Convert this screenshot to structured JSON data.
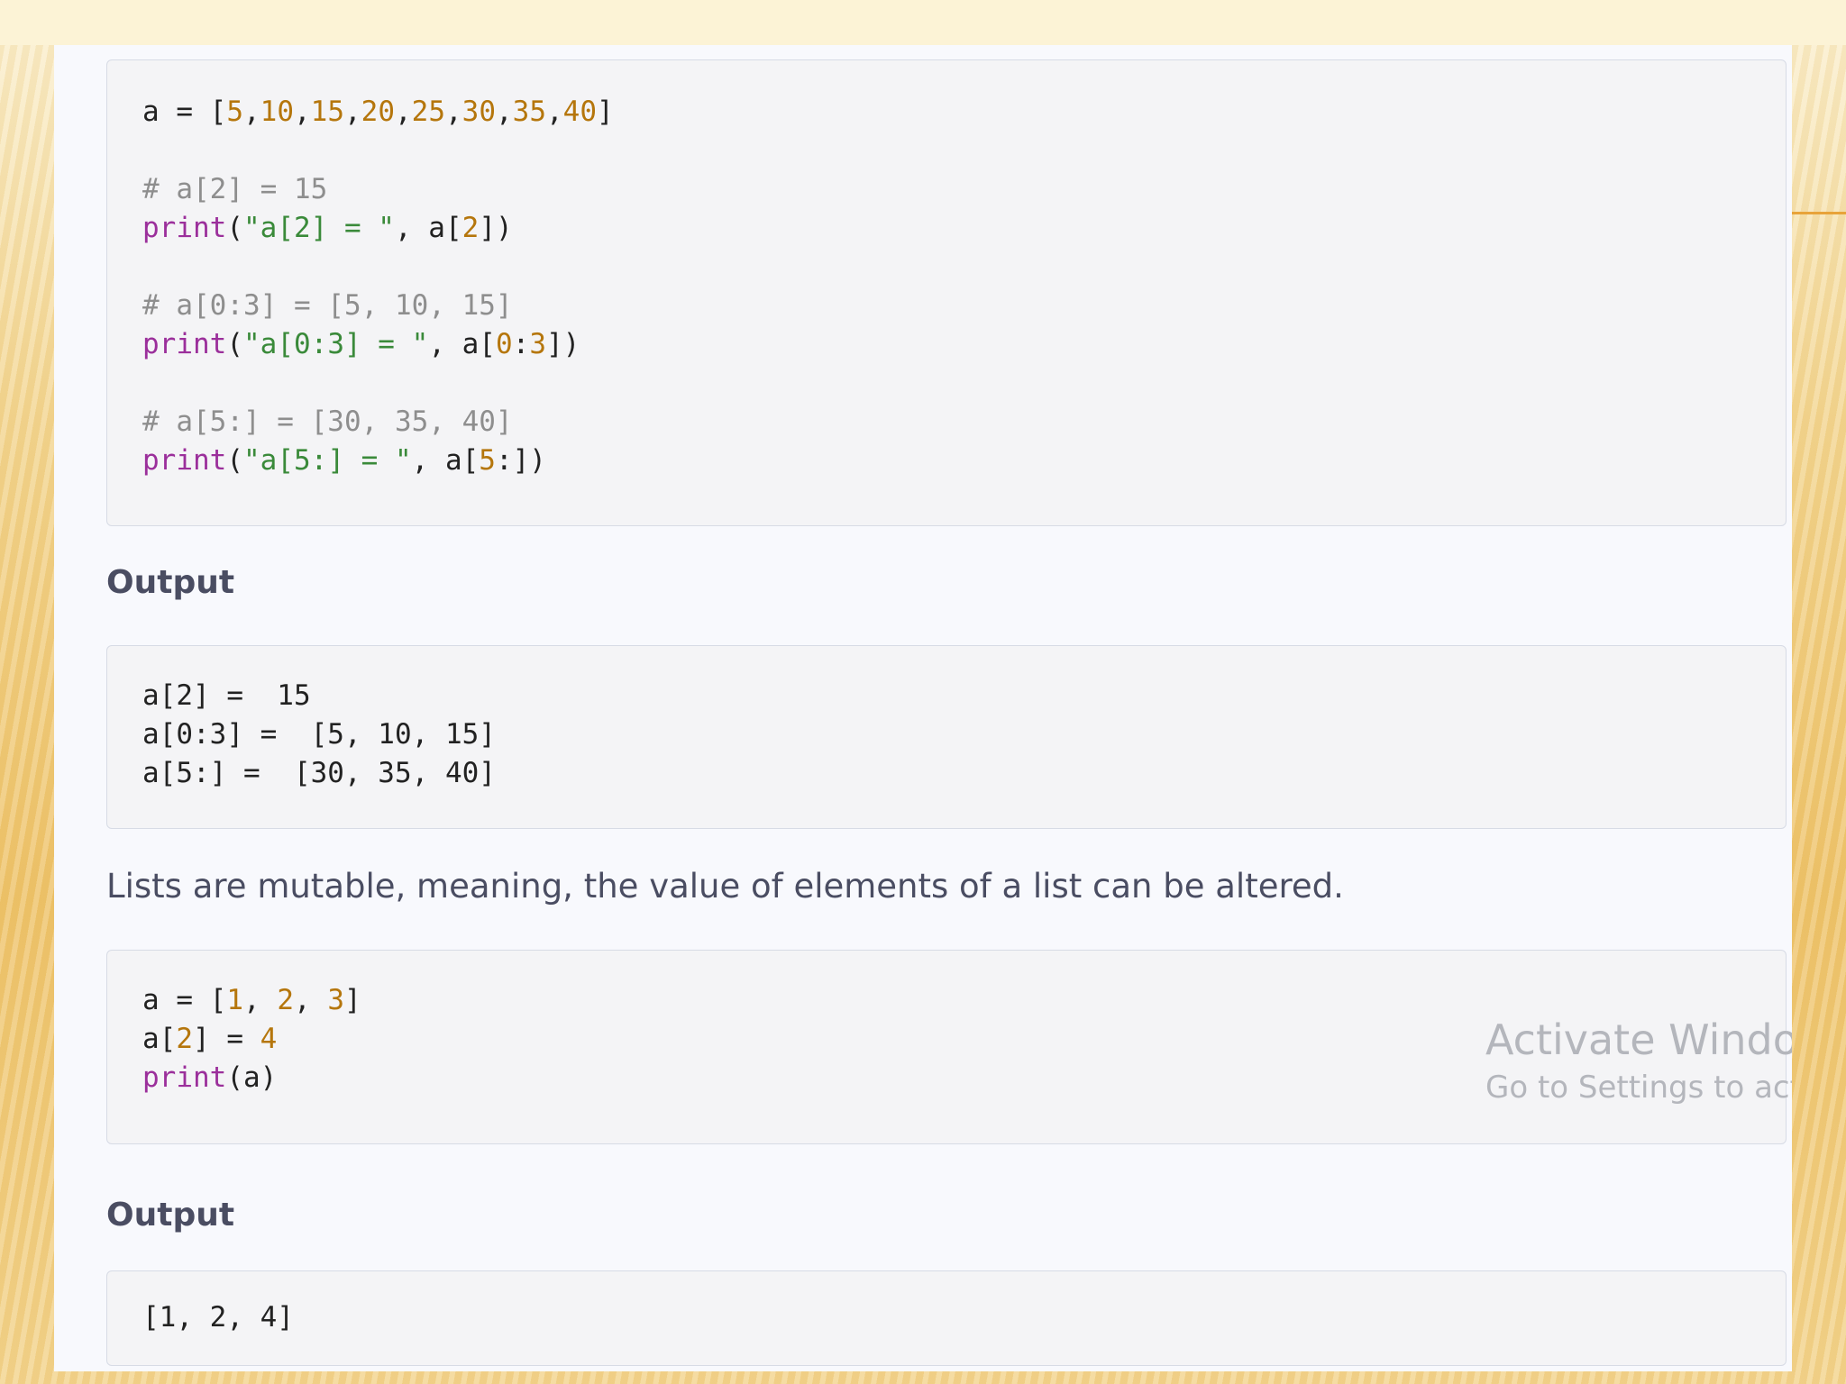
{
  "code_block_1": {
    "line1": "a = [5,10,15,20,25,30,35,40]",
    "comment1": "# a[2] = 15",
    "print1": "print(\"a[2] = \", a[2])",
    "comment2": "# a[0:3] = [5, 10, 15]",
    "print2": "print(\"a[0:3] = \", a[0:3])",
    "comment3": "# a[5:] = [30, 35, 40]",
    "print3": "print(\"a[5:] = \", a[5:])"
  },
  "output_heading_1": "Output",
  "output_block_1": {
    "line1": "a[2] =  15",
    "line2": "a[0:3] =  [5, 10, 15]",
    "line3": "a[5:] =  [30, 35, 40]"
  },
  "paragraph": "Lists are mutable, meaning, the value of elements of a list can be altered.",
  "code_block_2": {
    "line1": "a = [1, 2, 3]",
    "line2": "a[2] = 4",
    "line3": "print(a)"
  },
  "output_heading_2": "Output",
  "output_block_2": {
    "line1": "[1, 2, 4]"
  },
  "watermark": {
    "title": "Activate Windows",
    "subtitle": "Go to Settings to activate Windows."
  },
  "colors": {
    "comment": "#8e8e8e",
    "keyword": "#9b2f9b",
    "string": "#3a8a3a",
    "number": "#b5760c"
  }
}
